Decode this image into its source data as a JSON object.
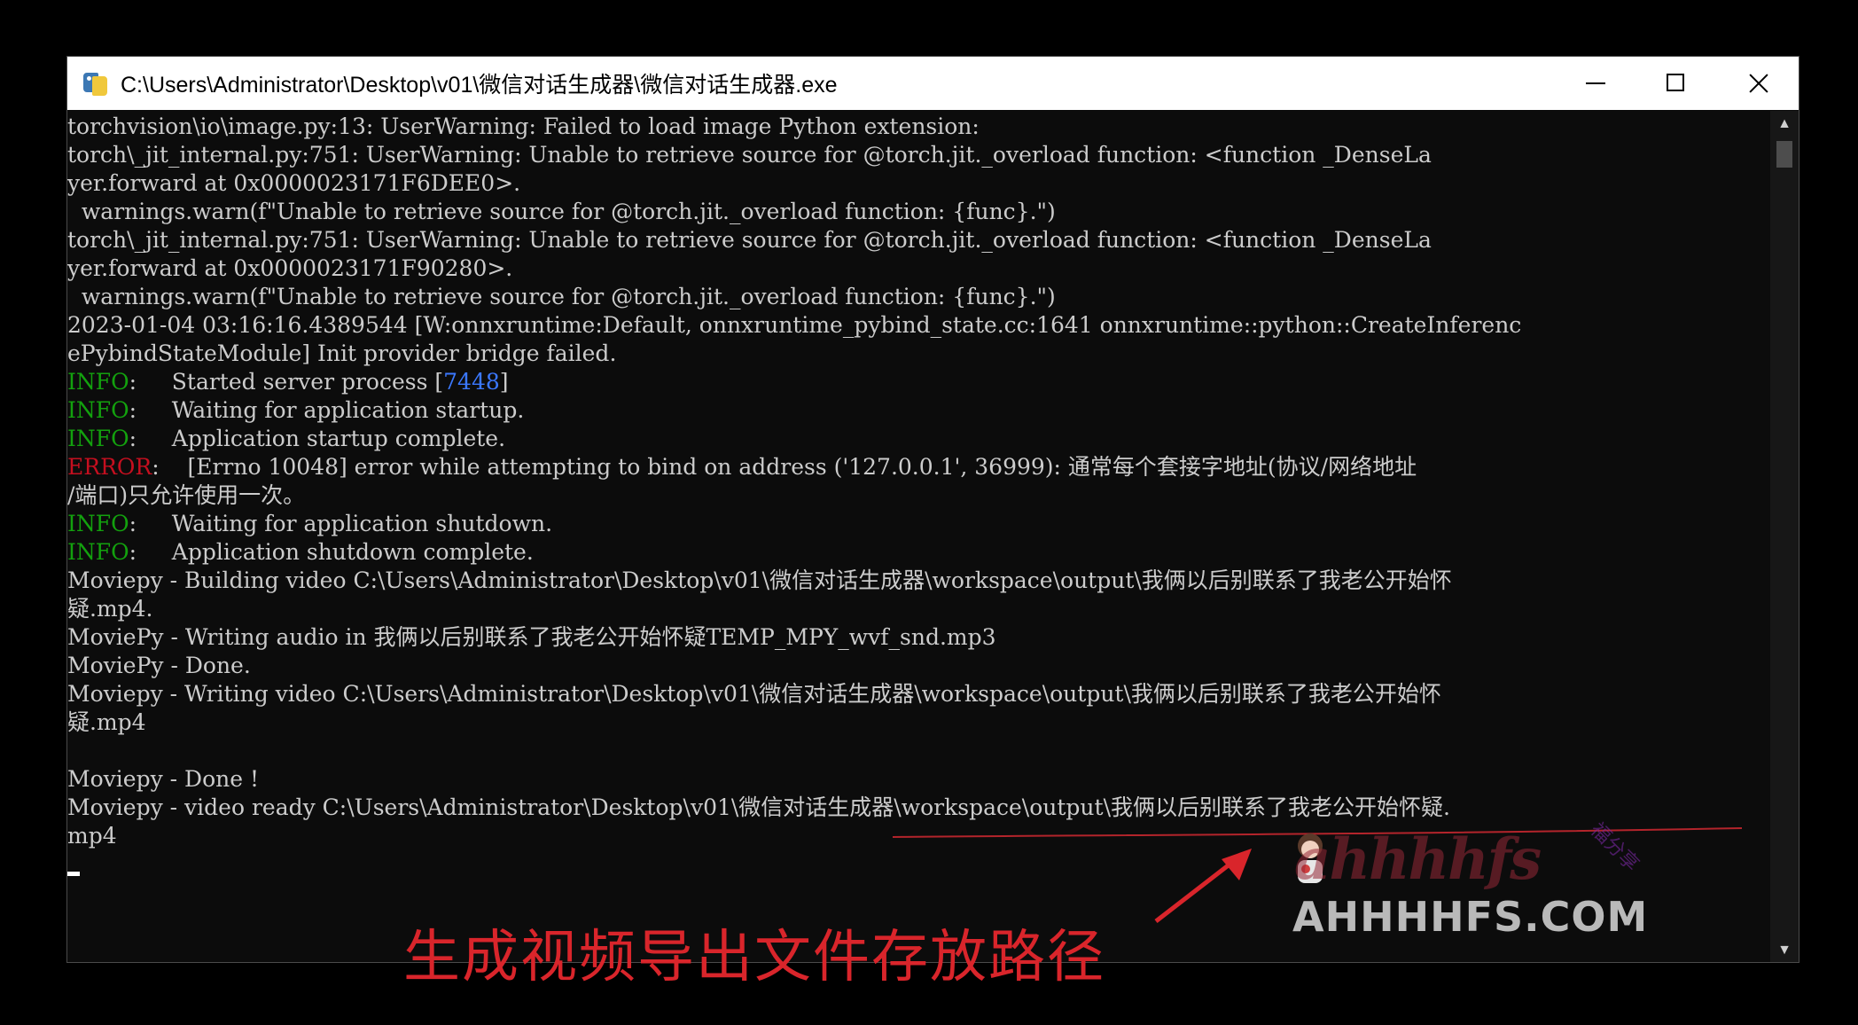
{
  "window": {
    "title": "C:\\Users\\Administrator\\Desktop\\v01\\微信对话生成器\\微信对话生成器.exe",
    "minimize_glyph": "minimize-icon",
    "maximize_glyph": "maximize-icon",
    "close_glyph": "close-icon"
  },
  "console": {
    "lines": [
      "torchvision\\io\\image.py:13: UserWarning: Failed to load image Python extension:",
      "torch\\_jit_internal.py:751: UserWarning: Unable to retrieve source for @torch.jit._overload function: <function _DenseLa",
      "yer.forward at 0x0000023171F6DEE0>.",
      "  warnings.warn(f\"Unable to retrieve source for @torch.jit._overload function: {func}.\")",
      "torch\\_jit_internal.py:751: UserWarning: Unable to retrieve source for @torch.jit._overload function: <function _DenseLa",
      "yer.forward at 0x0000023171F90280>.",
      "  warnings.warn(f\"Unable to retrieve source for @torch.jit._overload function: {func}.\")",
      "2023-01-04 03:16:16.4389544 [W:onnxruntime:Default, onnxruntime_pybind_state.cc:1641 onnxruntime::python::CreateInferenc",
      "ePybindStateModule] Init provider bridge failed.",
      "Moviepy - Building video C:\\Users\\Administrator\\Desktop\\v01\\微信对话生成器\\workspace\\output\\我俩以后别联系了我老公开始怀",
      "疑.mp4.",
      "MoviePy - Writing audio in 我俩以后别联系了我老公开始怀疑TEMP_MPY_wvf_snd.mp3",
      "MoviePy - Done.",
      "Moviepy - Writing video C:\\Users\\Administrator\\Desktop\\v01\\微信对话生成器\\workspace\\output\\我俩以后别联系了我老公开始怀",
      "疑.mp4",
      "",
      "Moviepy - Done !",
      "Moviepy - video ready C:\\Users\\Administrator\\Desktop\\v01\\微信对话生成器\\workspace\\output\\我俩以后别联系了我老公开始怀疑.",
      "mp4"
    ],
    "log": [
      {
        "level": "INFO",
        "sep": ":     ",
        "msg": "Started server process [",
        "pid": "7448",
        "tail": "]"
      },
      {
        "level": "INFO",
        "sep": ":     ",
        "msg": "Waiting for application startup."
      },
      {
        "level": "INFO",
        "sep": ":     ",
        "msg": "Application startup complete."
      },
      {
        "level": "ERROR",
        "sep": ":    ",
        "msg": "[Errno 10048] error while attempting to bind on address ('127.0.0.1', 36999): 通常每个套接字地址(协议/网络地址"
      },
      {
        "cont": "/端口)只允许使用一次。"
      },
      {
        "level": "INFO",
        "sep": ":     ",
        "msg": "Waiting for application shutdown."
      },
      {
        "level": "INFO",
        "sep": ":     ",
        "msg": "Application shutdown complete."
      }
    ],
    "colors": {
      "text": "#cccccc",
      "info": "#13a10e",
      "error": "#c50f1f",
      "number": "#3b78ff",
      "background": "#0c0c0c"
    }
  },
  "annotation": {
    "caption": "生成视频导出文件存放路径",
    "color": "#d9252b"
  },
  "watermark": {
    "logo": "ahhhhfs",
    "sub": "福分享",
    "site": "AHHHHFS.COM"
  }
}
